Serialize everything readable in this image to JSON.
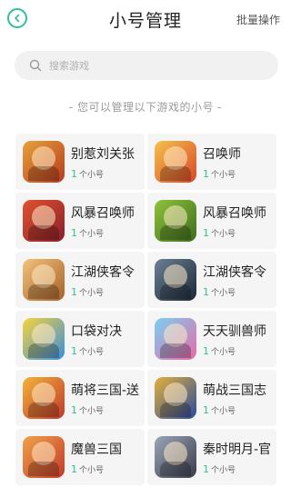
{
  "header": {
    "title": "小号管理",
    "batch_label": "批量操作"
  },
  "search": {
    "placeholder": "搜索游戏"
  },
  "subtitle": "- 您可以管理以下游戏的小号 -",
  "colors": {
    "accent": "#2fc09a"
  },
  "games": [
    {
      "name": "别惹刘关张",
      "count": "1",
      "count_suffix": "个小号",
      "icon": "warrior-portrait-icon",
      "palette": [
        "#b83a1f",
        "#e7a23a"
      ]
    },
    {
      "name": "召唤师",
      "count": "1",
      "count_suffix": "个小号",
      "icon": "summoner-hero-icon",
      "palette": [
        "#d8462a",
        "#f5c24a"
      ]
    },
    {
      "name": "风暴召唤师",
      "count": "1",
      "count_suffix": "个小号",
      "icon": "storm-warrior-icon",
      "palette": [
        "#8a1e2a",
        "#e0532e"
      ]
    },
    {
      "name": "风暴召唤师",
      "count": "1",
      "count_suffix": "个小号",
      "icon": "orc-face-icon",
      "palette": [
        "#3e6d1f",
        "#8fc23a"
      ]
    },
    {
      "name": "江湖侠客令",
      "count": "1",
      "count_suffix": "个小号",
      "icon": "heroine-portrait-icon",
      "palette": [
        "#a8612a",
        "#f2c27a"
      ]
    },
    {
      "name": "江湖侠客令",
      "count": "1",
      "count_suffix": "个小号",
      "icon": "swordsman-silhouette-icon",
      "palette": [
        "#1c2a38",
        "#6c7f95"
      ]
    },
    {
      "name": "口袋对决",
      "count": "1",
      "count_suffix": "个小号",
      "icon": "pocket-monster-icon",
      "palette": [
        "#3a8ee0",
        "#f7d43a"
      ]
    },
    {
      "name": "天天驯兽师",
      "count": "1",
      "count_suffix": "个小号",
      "icon": "beast-group-icon",
      "palette": [
        "#e86aa8",
        "#7ad0f0"
      ]
    },
    {
      "name": "萌将三国-送",
      "count": "1",
      "count_suffix": "个小号",
      "icon": "chibi-general-icon",
      "palette": [
        "#c0392b",
        "#f2b33a"
      ]
    },
    {
      "name": "萌战三国志",
      "count": "1",
      "count_suffix": "个小号",
      "icon": "armored-general-icon",
      "palette": [
        "#2a4a9e",
        "#e3b13a"
      ]
    },
    {
      "name": "魔兽三国",
      "count": "1",
      "count_suffix": "个小号",
      "icon": "red-hero-icon",
      "palette": [
        "#c23a2a",
        "#f0a24a"
      ]
    },
    {
      "name": "秦时明月-官",
      "count": "1",
      "count_suffix": "个小号",
      "icon": "swordsman-portrait-icon",
      "palette": [
        "#3a3a4a",
        "#9aa6b8"
      ]
    }
  ]
}
